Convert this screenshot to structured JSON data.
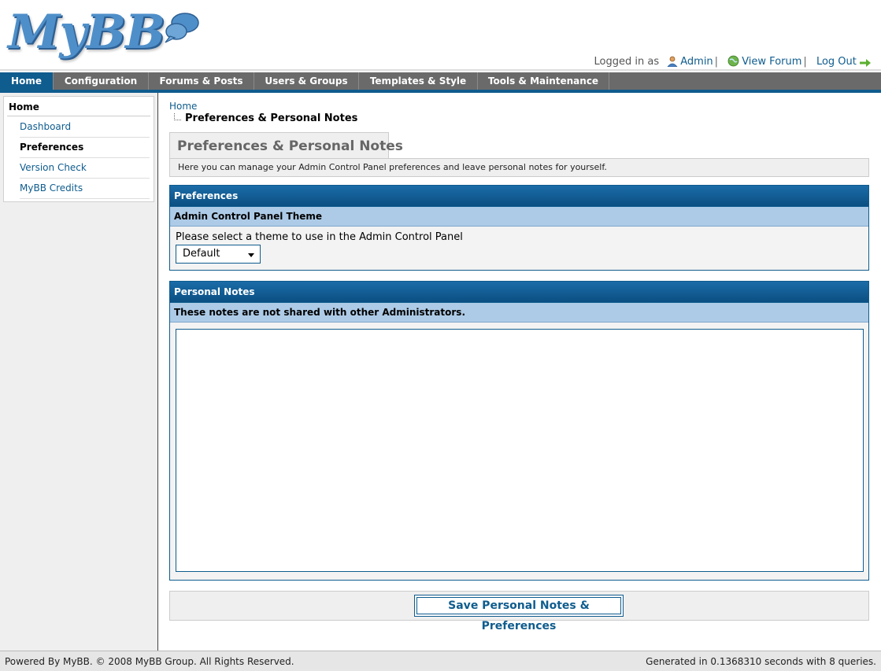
{
  "header": {
    "logo_text": "MyBB",
    "logged_in_as": "Logged in as",
    "user_name": "Admin",
    "view_forum": "View Forum",
    "log_out": "Log Out"
  },
  "menu": [
    {
      "label": "Home",
      "active": true
    },
    {
      "label": "Configuration"
    },
    {
      "label": "Forums & Posts"
    },
    {
      "label": "Users & Groups"
    },
    {
      "label": "Templates & Style"
    },
    {
      "label": "Tools & Maintenance"
    }
  ],
  "sidebar": {
    "title": "Home",
    "items": [
      {
        "label": "Dashboard"
      },
      {
        "label": "Preferences",
        "selected": true
      },
      {
        "label": "Version Check"
      },
      {
        "label": "MyBB Credits"
      }
    ]
  },
  "breadcrumb": {
    "home": "Home",
    "current": "Preferences & Personal Notes"
  },
  "page": {
    "tab_title": "Preferences & Personal Notes",
    "description": "Here you can manage your Admin Control Panel preferences and leave personal notes for yourself."
  },
  "preferences": {
    "heading": "Preferences",
    "subheading": "Admin Control Panel Theme",
    "label": "Please select a theme to use in the Admin Control Panel",
    "theme_value": "Default"
  },
  "notes": {
    "heading": "Personal Notes",
    "subheading": "These notes are not shared with other Administrators.",
    "value": ""
  },
  "submit": {
    "label": "Save Personal Notes & Preferences"
  },
  "footer": {
    "left": "Powered By MyBB. © 2008 MyBB Group. All Rights Reserved.",
    "right": "Generated in 0.1368310 seconds with 8 queries."
  },
  "colors": {
    "accent": "#0f5c8e",
    "menu_bg": "#6a6a6a",
    "subheader_bg": "#adcbe7"
  }
}
